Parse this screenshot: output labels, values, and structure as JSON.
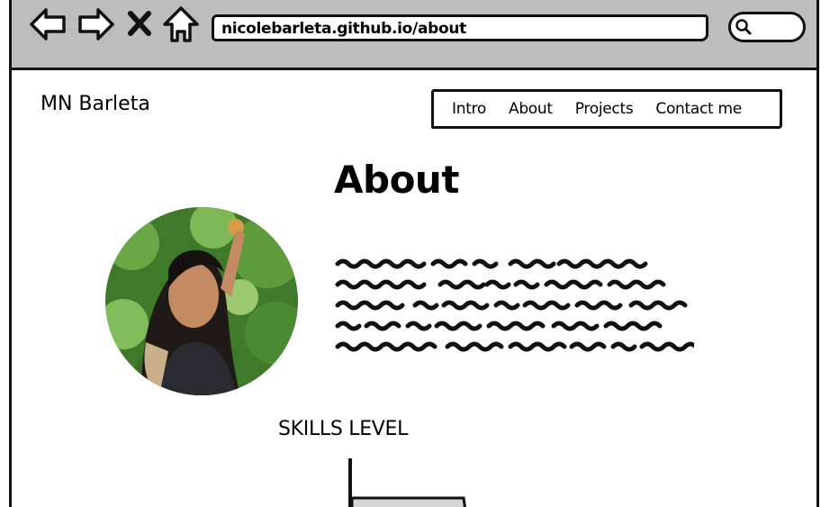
{
  "browser": {
    "url": "nicolebarleta.github.io/about",
    "icons": [
      "back-arrow-icon",
      "forward-arrow-icon",
      "close-icon",
      "home-icon",
      "search-icon"
    ]
  },
  "site": {
    "title": "MN Barleta",
    "nav": [
      {
        "label": "Intro"
      },
      {
        "label": "About"
      },
      {
        "label": "Projects"
      },
      {
        "label": "Contact me"
      }
    ]
  },
  "about": {
    "heading": "About",
    "photo_description": "profile-photo",
    "body_placeholder": "scribbled placeholder text (5 lines)"
  },
  "skills": {
    "heading": "SKILLS LEVEL"
  },
  "colors": {
    "toolbar": "#bdbdbd",
    "stroke": "#111111",
    "background": "#ffffff",
    "foliage": "#4f8a2e"
  }
}
